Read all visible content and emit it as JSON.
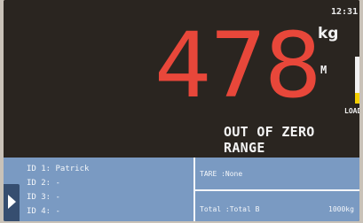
{
  "clock": "12:31",
  "weight": {
    "value": "478",
    "unit": "kg",
    "mode": "M",
    "status": "OUT OF ZERO RANGE"
  },
  "load": {
    "label": "LOAD",
    "level": 0.22,
    "fill_color": "#f5d000"
  },
  "ids": [
    {
      "label": "ID 1: Patrick"
    },
    {
      "label": "ID 2: -"
    },
    {
      "label": "ID 3: -"
    },
    {
      "label": "ID 4: -"
    }
  ],
  "tare": "TARE  :None",
  "total": {
    "label": "Total :Total B",
    "value": "1000kg"
  },
  "colors": {
    "weight": "#e8473a",
    "panel": "#7a9ac2",
    "screen": "#2a2520"
  },
  "icons": {
    "expand": "triangle-right-icon"
  }
}
